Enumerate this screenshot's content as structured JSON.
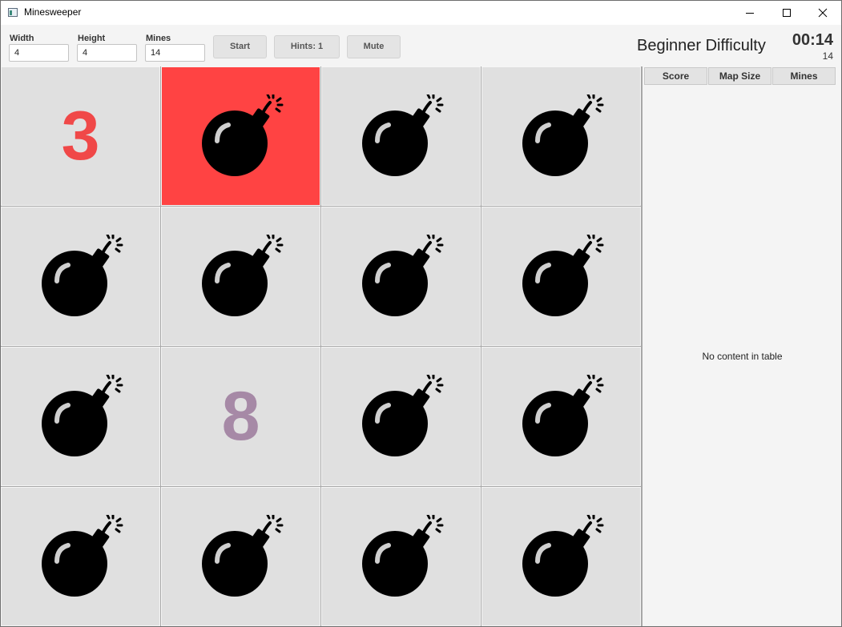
{
  "window": {
    "title": "Minesweeper"
  },
  "toolbar": {
    "width_label": "Width",
    "width_value": "4",
    "height_label": "Height",
    "height_value": "4",
    "mines_label": "Mines",
    "mines_value": "14",
    "start_label": "Start",
    "hints_label": "Hints: 1",
    "mute_label": "Mute",
    "difficulty": "Beginner Difficulty",
    "timer": "00:14",
    "mines_remaining": "14"
  },
  "board": {
    "rows": 4,
    "cols": 4,
    "cells": [
      {
        "type": "number",
        "value": "3",
        "color": "#f04848"
      },
      {
        "type": "mine",
        "exploded": true
      },
      {
        "type": "mine"
      },
      {
        "type": "mine"
      },
      {
        "type": "mine"
      },
      {
        "type": "mine"
      },
      {
        "type": "mine"
      },
      {
        "type": "mine"
      },
      {
        "type": "mine"
      },
      {
        "type": "number",
        "value": "8",
        "color": "#a689a6"
      },
      {
        "type": "mine"
      },
      {
        "type": "mine"
      },
      {
        "type": "mine"
      },
      {
        "type": "mine"
      },
      {
        "type": "mine"
      },
      {
        "type": "mine"
      }
    ],
    "exploded_color": "#ff4343"
  },
  "score_table": {
    "columns": [
      "Score",
      "Map Size",
      "Mines"
    ],
    "empty_message": "No content in table"
  }
}
